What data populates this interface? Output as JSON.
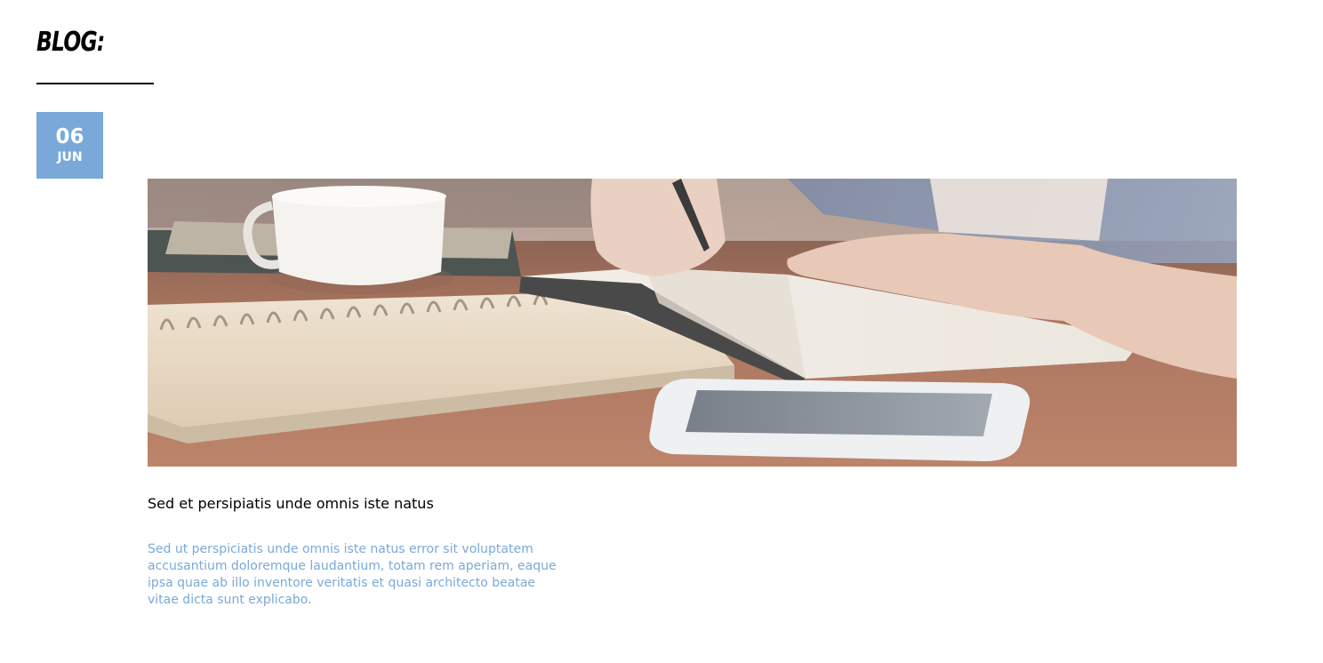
{
  "section": {
    "title": "BLOG:"
  },
  "post": {
    "date_day": "06",
    "date_month": "JUN",
    "title": "Sed et persipiatis unde omnis iste natus",
    "excerpt": "Sed ut perspiciatis unde omnis iste natus error sit voluptatem accusantium doloremque laudantium, totam rem aperiam, eaque ipsa quae ab illo inventore veritatis et quasi architecto beatae vitae dicta sunt explicabo."
  },
  "colors": {
    "accent": "#7aa9d9",
    "text": "#000000",
    "background": "#ffffff"
  }
}
